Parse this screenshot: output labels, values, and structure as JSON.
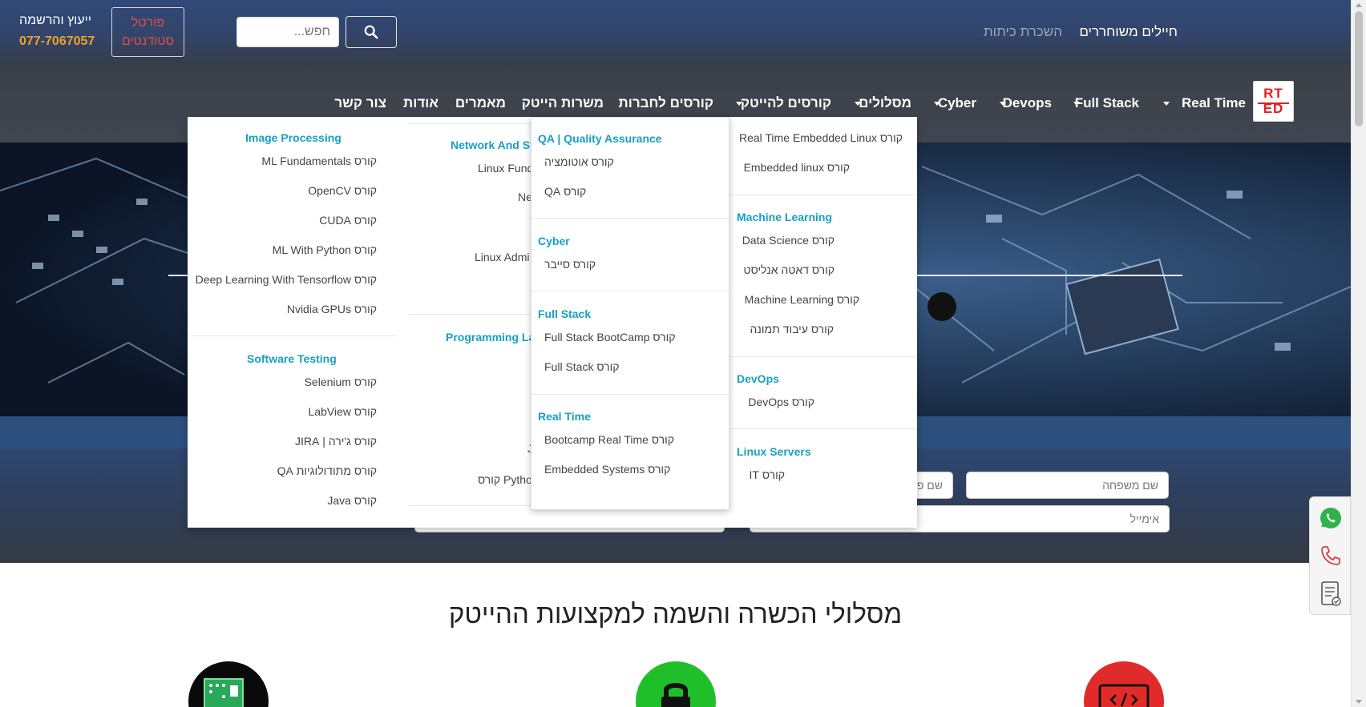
{
  "topbar": {
    "links": [
      "חיילים משוחררים",
      "השכרת כיתות"
    ],
    "search_placeholder": "חפש...",
    "portal_label_line1": "פורטל",
    "portal_label_line2": "סטודנטים",
    "contact_label": "ייעוץ והרשמה",
    "contact_phone": "077-7067057"
  },
  "logo": {
    "line1": "RT",
    "line2": "ED"
  },
  "nav": {
    "items": [
      "Real Time",
      "Full Stack",
      "Devops",
      "Cyber",
      "מסלולים",
      "קורסים להייטק",
      "קורסים לחברות",
      "משרות הייטק",
      "מאמרים",
      "אודות",
      "צור קשר"
    ]
  },
  "dropdown": {
    "col_right": {
      "group0": {
        "items": [
          "קורס Real Time Embedded Linux",
          "קורס Embedded linux"
        ]
      },
      "group1": {
        "title": "Machine Learning",
        "items": [
          "קורס Data Science",
          "קורס דאטה אנליסט",
          "קורס Machine Learning",
          "קורס עיבוד תמונה"
        ]
      },
      "group2": {
        "title": "DevOps",
        "items": [
          "קורס DevOps"
        ]
      },
      "group3": {
        "title": "Linux Servers",
        "items": [
          "קורס IT"
        ]
      }
    },
    "col_mid": {
      "group0": {
        "title": "QA | Quality Assurance",
        "items": [
          "קורס אוטומציה",
          "קורס QA"
        ]
      },
      "group1": {
        "title": "Cyber",
        "items": [
          "קורס סייבר"
        ]
      },
      "group2": {
        "title": "Full Stack",
        "items": [
          "קורס Full Stack BootCamp",
          "קורס Full Stack"
        ]
      },
      "group3": {
        "title": "Real Time",
        "items": [
          "קורס Bootcamp Real Time",
          "קורס Embedded Systems"
        ]
      }
    },
    "col_behind": {
      "title1": "Network And Sy",
      "items1": [
        "Linux Fund",
        "Ne",
        "Linux Admi"
      ],
      "title2": "Programming La",
      "items2": [
        "J",
        "Python קורס"
      ]
    },
    "col_left": {
      "group0": {
        "title": "Image Processing",
        "items": [
          "קורס ML Fundamentals",
          "קורס OpenCV",
          "קורס CUDA",
          "קורס ML With Python",
          "קורס Deep Learning With Tensorflow",
          "קורס Nvidia GPUs"
        ]
      },
      "group1": {
        "title": "Software Testing",
        "items": [
          "קורס Selenium",
          "קורס LabView",
          "קורס ג'ירה | JIRA",
          "קורס מתודולוגיות QA",
          "קורס Java"
        ]
      }
    }
  },
  "form": {
    "last_name_placeholder": "שם משפחה",
    "first_name_placeholder": "שם פ",
    "email_placeholder": "אימייל",
    "band_fragment": "ש"
  },
  "section": {
    "title": "מסלולי הכשרה והשמה למקצועות ההייטק"
  },
  "icons": [
    "search-icon",
    "whatsapp-icon",
    "phone-icon",
    "form-icon",
    "chip-icon",
    "lock-icon",
    "code-icon"
  ],
  "colors": {
    "accent_teal": "#17a0c4",
    "phone_orange": "#f0a12b",
    "brand_red": "#e31e24"
  }
}
